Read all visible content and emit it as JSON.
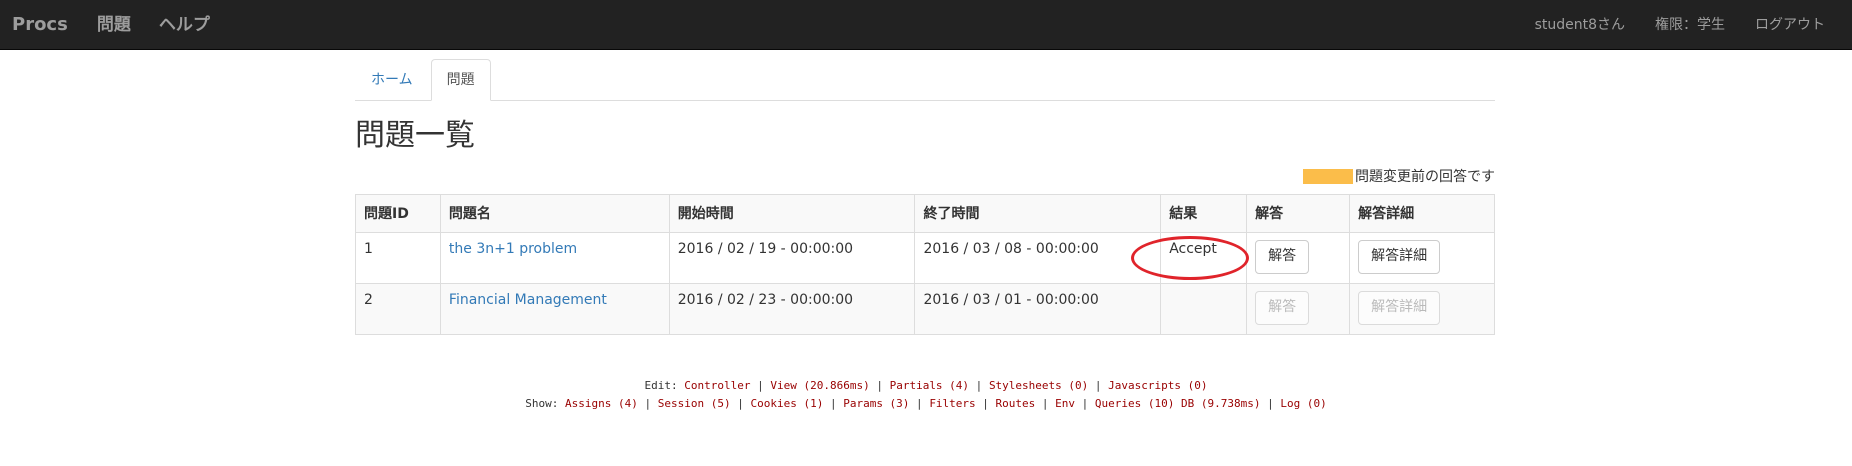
{
  "navbar": {
    "brand": "Procs",
    "left_items": [
      "問題",
      "ヘルプ"
    ],
    "user": "student8さん",
    "role": "権限：学生",
    "logout": "ログアウト"
  },
  "tabs": [
    {
      "label": "ホーム",
      "active": false
    },
    {
      "label": "問題",
      "active": true
    }
  ],
  "page_title": "問題一覧",
  "legend": {
    "text": "問題変更前の回答です",
    "color": "#fbbd4a"
  },
  "table": {
    "headers": [
      "問題ID",
      "問題名",
      "開始時間",
      "終了時間",
      "結果",
      "解答",
      "解答詳細"
    ],
    "rows": [
      {
        "id": "1",
        "name": "the 3n+1 problem",
        "start": "2016 / 02 / 19 - 00:00:00",
        "end": "2016 / 03 / 08 - 00:00:00",
        "result": "Accept",
        "answer_button": "解答",
        "detail_button": "解答詳細",
        "enabled": true
      },
      {
        "id": "2",
        "name": "Financial Management",
        "start": "2016 / 02 / 23 - 00:00:00",
        "end": "2016 / 03 / 01 - 00:00:00",
        "result": "",
        "answer_button": "解答",
        "detail_button": "解答詳細",
        "enabled": false
      }
    ]
  },
  "debug": {
    "edit_label": "Edit:",
    "edit_links": [
      "Controller",
      "View (20.866ms)",
      "Partials (4)",
      "Stylesheets (0)",
      "Javascripts (0)"
    ],
    "show_label": "Show:",
    "show_links": [
      "Assigns (4)",
      "Session (5)",
      "Cookies (1)",
      "Params (3)",
      "Filters",
      "Routes",
      "Env",
      "Queries (10) DB (9.738ms)",
      "Log (0)"
    ]
  },
  "colors": {
    "navbar_bg": "#222222",
    "link": "#337ab7",
    "highlight": "#e0242b",
    "debug_link": "#990000"
  }
}
